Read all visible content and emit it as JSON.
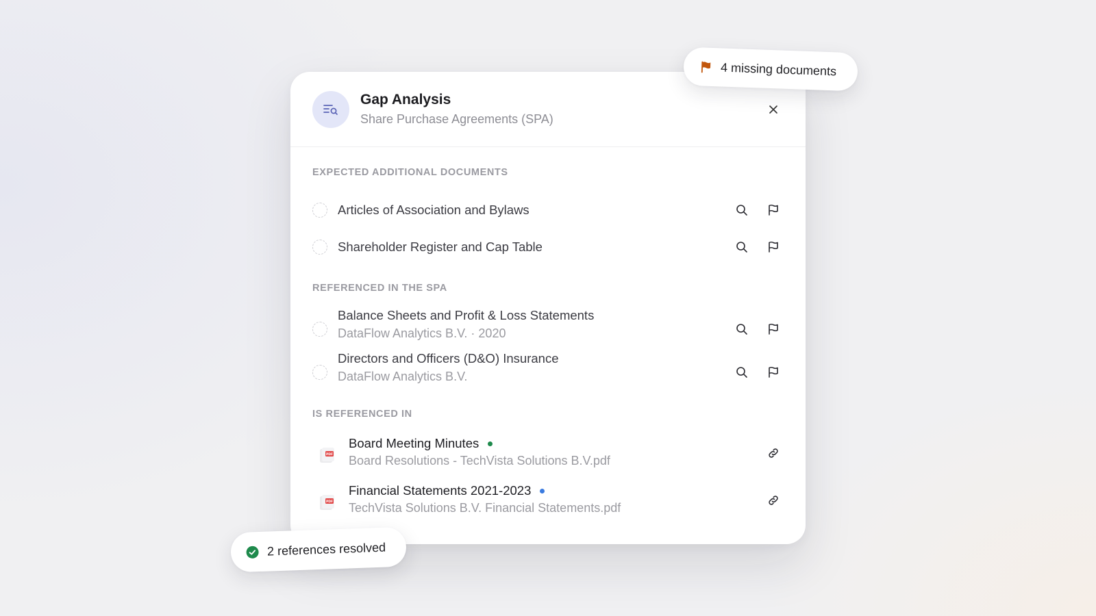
{
  "header": {
    "title": "Gap Analysis",
    "subtitle": "Share Purchase Agreements (SPA)",
    "icon": "search-list-icon"
  },
  "sections": {
    "expected": {
      "label": "EXPECTED ADDITIONAL DOCUMENTS",
      "items": [
        {
          "title": "Articles of Association and Bylaws"
        },
        {
          "title": "Shareholder Register and Cap Table"
        }
      ]
    },
    "referenced_in_spa": {
      "label": "REFERENCED IN THE SPA",
      "items": [
        {
          "title": "Balance Sheets and Profit & Loss Statements",
          "subtitle": "DataFlow Analytics B.V. · 2020"
        },
        {
          "title": "Directors and Officers (D&O) Insurance",
          "subtitle": "DataFlow Analytics B.V."
        }
      ]
    },
    "is_referenced_in": {
      "label": "IS REFERENCED IN",
      "items": [
        {
          "title": "Board Meeting Minutes",
          "file": "Board Resolutions - TechVista Solutions B.V.pdf",
          "status_color": "#1e8a4c"
        },
        {
          "title": "Financial Statements 2021-2023",
          "file": "TechVista Solutions B.V. Financial Statements.pdf",
          "status_color": "#3a7be0"
        }
      ]
    }
  },
  "badges": {
    "missing": {
      "text": "4 missing documents",
      "icon": "flag-icon",
      "color": "#c2570c"
    },
    "resolved": {
      "text": "2 references resolved",
      "icon": "check-circle-icon",
      "color": "#1e8a4c"
    }
  },
  "pdf_label": "PDF"
}
